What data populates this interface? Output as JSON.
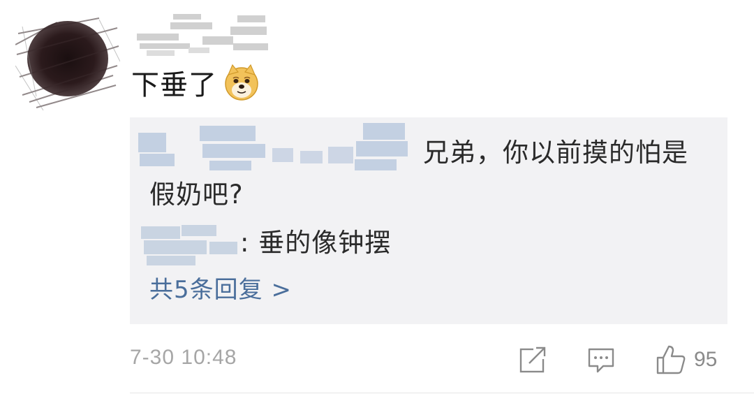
{
  "comment": {
    "text": "下垂了",
    "emoji": "doge-emoji"
  },
  "replies": {
    "first": {
      "text_line1": "兄弟，你以前摸的怕是",
      "text_line2": "假奶吧?"
    },
    "second": {
      "text": ": 垂的像钟摆"
    },
    "more_label": "共5条回复 >"
  },
  "footer": {
    "timestamp": "7-30 10:48",
    "like_count": "95",
    "icons": [
      "share-icon",
      "comment-icon",
      "like-icon"
    ]
  },
  "colors": {
    "reply_bg": "#f2f2f4",
    "link": "#4a6e9b",
    "meta": "#a6a6a6"
  }
}
